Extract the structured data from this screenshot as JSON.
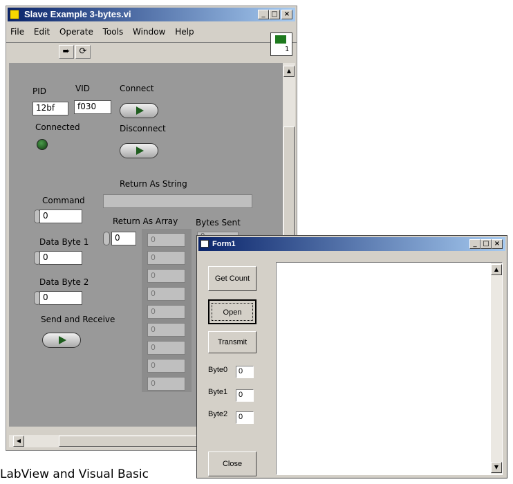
{
  "labview": {
    "title": "Slave Example 3-bytes.vi",
    "menu": [
      "File",
      "Edit",
      "Operate",
      "Tools",
      "Window",
      "Help"
    ],
    "connector_count": "1",
    "pid_label": "PID",
    "pid_value": "12bf",
    "vid_label": "VID",
    "vid_value": "f030",
    "connect_label": "Connect",
    "connected_label": "Connected",
    "disconnect_label": "Disconnect",
    "return_string_label": "Return As String",
    "command_label": "Command",
    "command_value": "0",
    "return_array_label": "Return As Array",
    "array_index": "0",
    "bytes_sent_label": "Bytes Sent",
    "bytes_sent_value": "0",
    "data_byte1_label": "Data Byte 1",
    "data_byte1_value": "0",
    "data_byte2_label": "Data Byte 2",
    "data_byte2_value": "0",
    "send_receive_label": "Send and Receive",
    "array_values": [
      "0",
      "0",
      "0",
      "0",
      "0",
      "0",
      "0",
      "0",
      "0"
    ]
  },
  "form": {
    "title": "Form1",
    "get_count": "Get Count",
    "open": "Open",
    "transmit": "Transmit",
    "byte0_label": "Byte0",
    "byte0_value": "0",
    "byte1_label": "Byte1",
    "byte1_value": "0",
    "byte2_label": "Byte2",
    "byte2_value": "0",
    "close": "Close"
  },
  "caption": "LabView and Visual Basic",
  "colors": {
    "titlebar": "#0a246a",
    "panel": "#999999",
    "window": "#d4d0c8",
    "led": "#1e5d1e"
  }
}
